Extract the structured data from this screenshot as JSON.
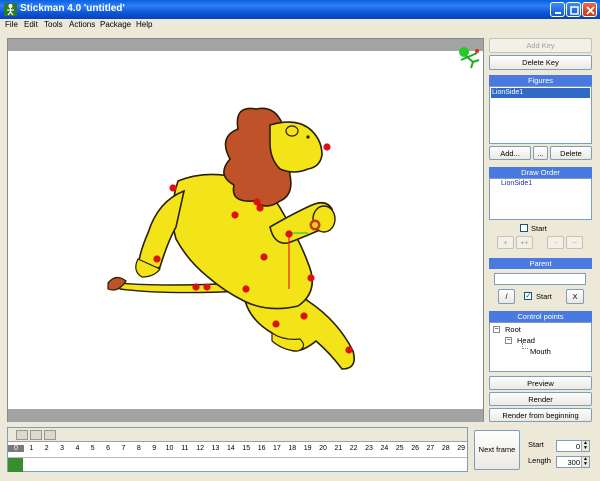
{
  "window": {
    "title": "Stickman 4.0 'untitled'",
    "icon": "stickman-app-icon",
    "controls": [
      "minimize-icon",
      "maximize-icon",
      "close-icon"
    ]
  },
  "menu": [
    "File",
    "Edit",
    "Tools",
    "Actions",
    "Package",
    "Help"
  ],
  "canvas": {
    "figure": "lion side view",
    "control_point_color": "#dd1111",
    "body_color": "#f2e418",
    "mane_color": "#c0522a",
    "corner_icon": "running-stickman-icon"
  },
  "right_panel": {
    "add_key": "Add Key",
    "delete_key": "Delete Key",
    "figures_header": "Figures",
    "figures_list": [
      "LionSide1"
    ],
    "add": "Add...",
    "dots": "...",
    "delete": "Delete",
    "draw_order_header": "Draw Order",
    "draw_order_list": [
      "LionSide1"
    ],
    "start_label": "Start",
    "order_buttons": [
      "+",
      "++",
      "-",
      "--"
    ],
    "parent_header": "Parent",
    "parent_value": "",
    "slash_button": "/",
    "parent_start_label": "Start",
    "x_button": "X",
    "control_points_header": "Control points",
    "tree": {
      "root": "Root",
      "head": "Head",
      "mouth": "Mouth"
    },
    "preview": "Preview",
    "render": "Render",
    "render_from_beginning": "Render from beginning"
  },
  "timeline": {
    "frames": [
      "0",
      "1",
      "2",
      "3",
      "4",
      "5",
      "6",
      "7",
      "8",
      "9",
      "10",
      "11",
      "12",
      "13",
      "14",
      "15",
      "16",
      "17",
      "18",
      "19",
      "20",
      "21",
      "22",
      "23",
      "24",
      "25",
      "26",
      "27",
      "28",
      "29"
    ],
    "next_frame": "Next frame",
    "start_label": "Start",
    "start_value": "0",
    "length_label": "Length",
    "length_value": "300"
  }
}
